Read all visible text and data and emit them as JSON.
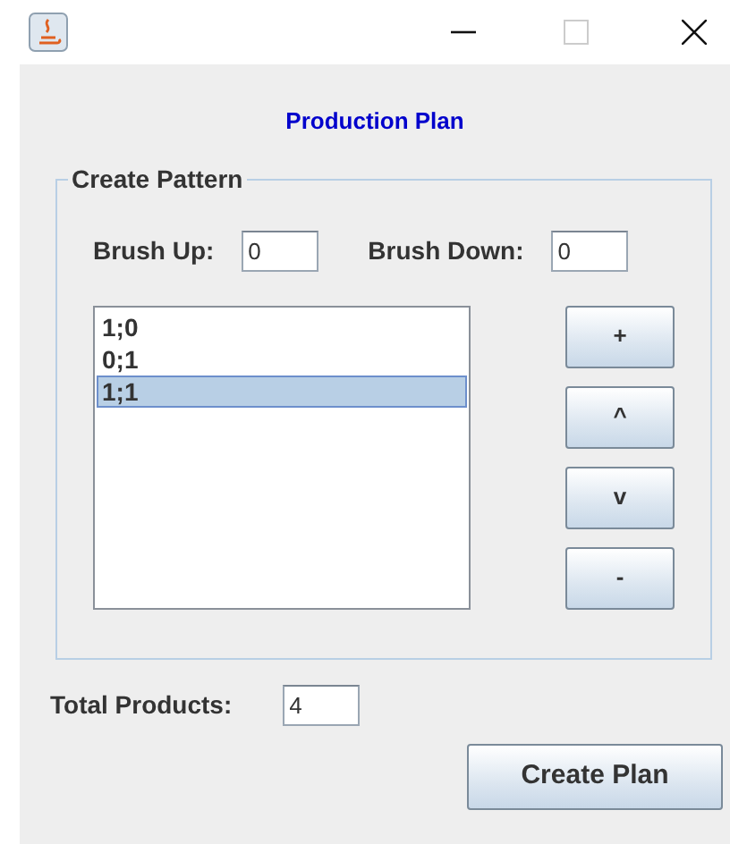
{
  "heading": "Production Plan",
  "pattern_group": {
    "title": "Create Pattern",
    "fields": [
      {
        "label": "Brush Up:",
        "value": "0"
      },
      {
        "label": "Brush Down:",
        "value": "0"
      }
    ],
    "pattern_list": [
      {
        "text": "1;0",
        "selected": false
      },
      {
        "text": "0;1",
        "selected": false
      },
      {
        "text": "1;1",
        "selected": true
      }
    ],
    "buttons": [
      "+",
      "^",
      "v",
      "-"
    ]
  },
  "total_products": {
    "label": "Total Products:",
    "value": "4"
  },
  "create_button": "Create Plan"
}
